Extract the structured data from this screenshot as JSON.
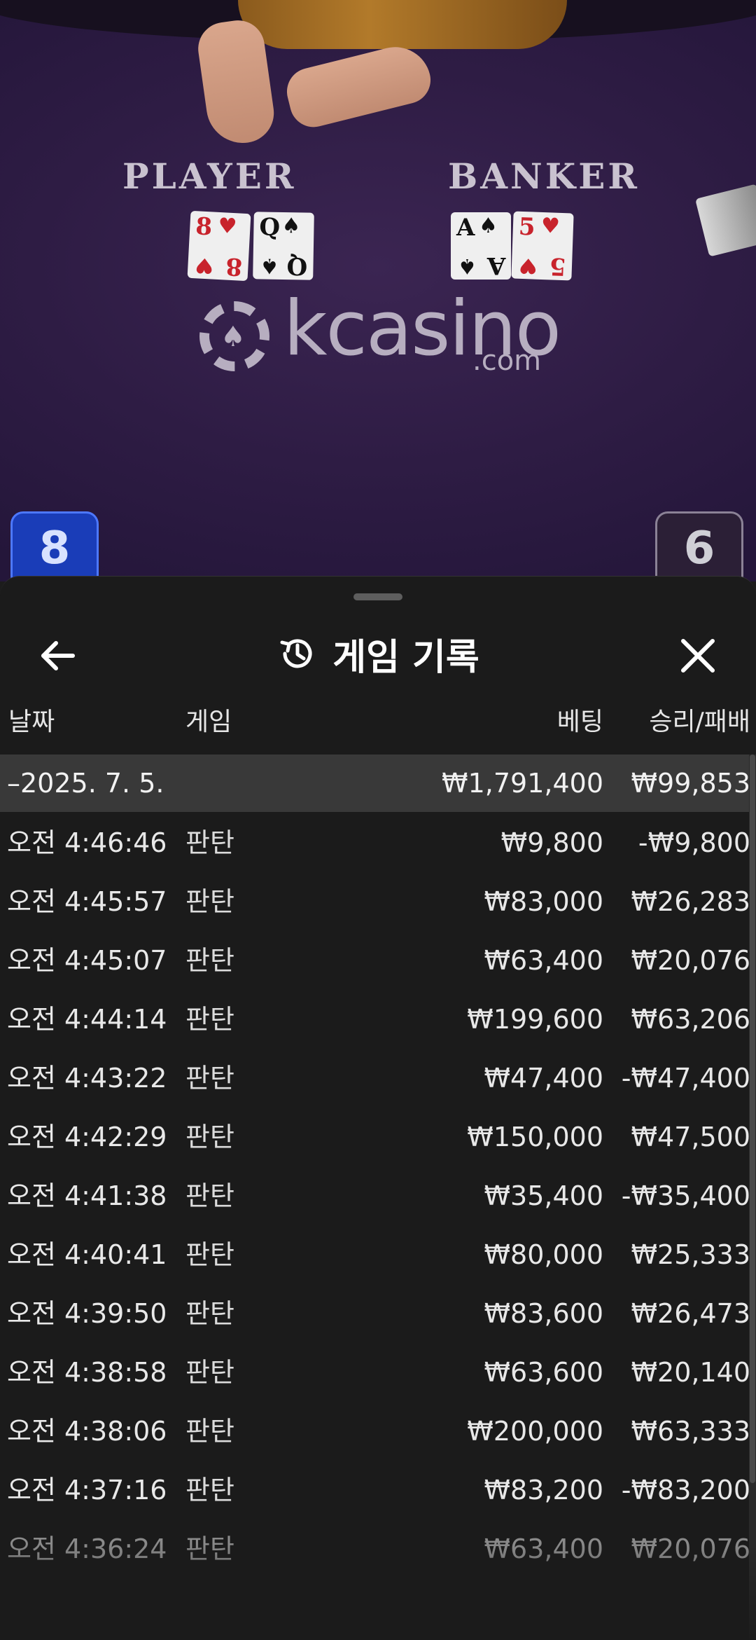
{
  "video": {
    "player_label": "PLAYER",
    "banker_label": "BANKER",
    "player_cards": [
      {
        "rank": "8",
        "suit": "♥",
        "color": "red"
      },
      {
        "rank": "Q",
        "suit": "♠",
        "color": "black"
      }
    ],
    "banker_cards": [
      {
        "rank": "A",
        "suit": "♠",
        "color": "black"
      },
      {
        "rank": "5",
        "suit": "♥",
        "color": "red"
      }
    ],
    "logo_text": "kcasino",
    "logo_suffix": ".com",
    "player_score": "8",
    "banker_score": "6"
  },
  "sheet": {
    "title": "게임 기록",
    "title_icon": "history-icon",
    "back_icon": "arrow-left-icon",
    "close_icon": "close-icon",
    "columns": {
      "date": "날짜",
      "game": "게임",
      "bet": "베팅",
      "win_loss": "승리/패배"
    },
    "group": {
      "date": "–2025. 7. 5.",
      "bet": "₩1,791,400",
      "win_loss": "₩99,853"
    },
    "rows": [
      {
        "time": "오전 4:46:46",
        "game": "판탄",
        "bet": "₩9,800",
        "win_loss": "-₩9,800"
      },
      {
        "time": "오전 4:45:57",
        "game": "판탄",
        "bet": "₩83,000",
        "win_loss": "₩26,283"
      },
      {
        "time": "오전 4:45:07",
        "game": "판탄",
        "bet": "₩63,400",
        "win_loss": "₩20,076"
      },
      {
        "time": "오전 4:44:14",
        "game": "판탄",
        "bet": "₩199,600",
        "win_loss": "₩63,206"
      },
      {
        "time": "오전 4:43:22",
        "game": "판탄",
        "bet": "₩47,400",
        "win_loss": "-₩47,400"
      },
      {
        "time": "오전 4:42:29",
        "game": "판탄",
        "bet": "₩150,000",
        "win_loss": "₩47,500"
      },
      {
        "time": "오전 4:41:38",
        "game": "판탄",
        "bet": "₩35,400",
        "win_loss": "-₩35,400"
      },
      {
        "time": "오전 4:40:41",
        "game": "판탄",
        "bet": "₩80,000",
        "win_loss": "₩25,333"
      },
      {
        "time": "오전 4:39:50",
        "game": "판탄",
        "bet": "₩83,600",
        "win_loss": "₩26,473"
      },
      {
        "time": "오전 4:38:58",
        "game": "판탄",
        "bet": "₩63,600",
        "win_loss": "₩20,140"
      },
      {
        "time": "오전 4:38:06",
        "game": "판탄",
        "bet": "₩200,000",
        "win_loss": "₩63,333"
      },
      {
        "time": "오전 4:37:16",
        "game": "판탄",
        "bet": "₩83,200",
        "win_loss": "-₩83,200"
      },
      {
        "time": "오전 4:36:24",
        "game": "판탄",
        "bet": "₩63,400",
        "win_loss": "₩20,076"
      }
    ]
  }
}
